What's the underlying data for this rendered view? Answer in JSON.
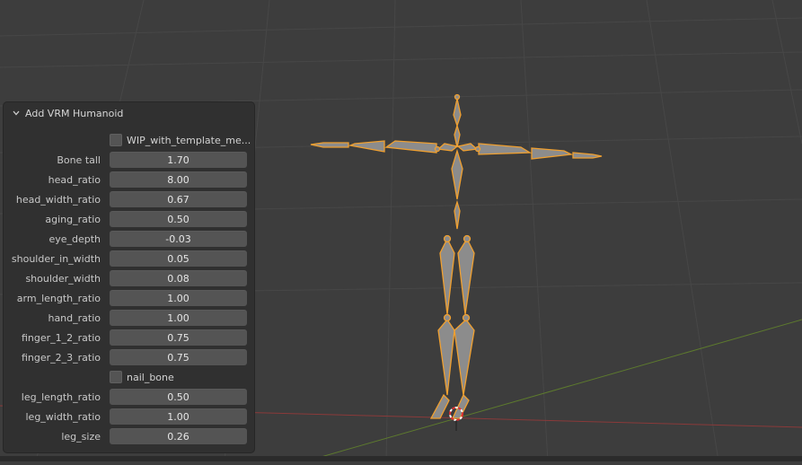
{
  "panel": {
    "title": "Add VRM Humanoid",
    "toggle_icon": "chevron-down-icon",
    "wip_checkbox_label": "WIP_with_template_me...",
    "wip_checked": false,
    "fields": [
      {
        "label": "Bone tall",
        "value": "1.70"
      },
      {
        "label": "head_ratio",
        "value": "8.00"
      },
      {
        "label": "head_width_ratio",
        "value": "0.67"
      },
      {
        "label": "aging_ratio",
        "value": "0.50"
      },
      {
        "label": "eye_depth",
        "value": "-0.03"
      },
      {
        "label": "shoulder_in_width",
        "value": "0.05"
      },
      {
        "label": "shoulder_width",
        "value": "0.08"
      },
      {
        "label": "arm_length_ratio",
        "value": "1.00"
      },
      {
        "label": "hand_ratio",
        "value": "1.00"
      },
      {
        "label": "finger_1_2_ratio",
        "value": "0.75"
      },
      {
        "label": "finger_2_3_ratio",
        "value": "0.75"
      }
    ],
    "nail_bone_label": "nail_bone",
    "nail_bone_checked": false,
    "fields2": [
      {
        "label": "leg_length_ratio",
        "value": "0.50"
      },
      {
        "label": "leg_width_ratio",
        "value": "1.00"
      },
      {
        "label": "leg_size",
        "value": "0.26"
      }
    ]
  },
  "viewport": {
    "background_color": "#3d3d3d",
    "grid_color": "#474747",
    "x_axis_color": "#8a3a3a",
    "y_axis_color": "#5d7a2e",
    "selection_color": "#f0a030",
    "bone_fill_color": "#8c8c8c"
  }
}
